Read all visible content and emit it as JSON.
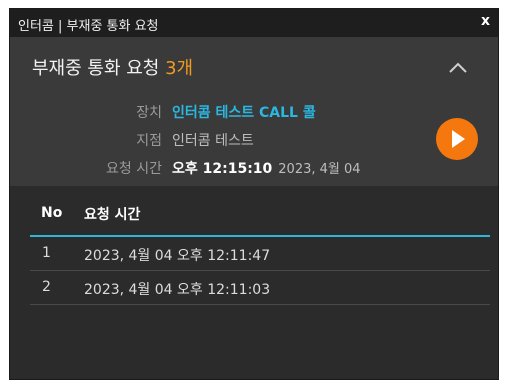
{
  "window": {
    "title": "인터콤 | 부재중 통화 요청",
    "close": "x"
  },
  "header": {
    "heading_prefix": "부재중 통화 요청 ",
    "count": "3개",
    "device_label": "장치",
    "device_value": "인터콤 테스트 CALL 콜",
    "branch_label": "지점",
    "branch_value": "인터콤 테스트",
    "request_label": "요청 시간",
    "request_time": "오후 12:15:10",
    "request_date": "2023, 4월 04"
  },
  "table": {
    "columns": [
      "No",
      "요청 시간"
    ],
    "rows": [
      {
        "no": "1",
        "time": "2023, 4월 04 오후 12:11:47"
      },
      {
        "no": "2",
        "time": "2023, 4월 04 오후 12:11:03"
      }
    ]
  },
  "colors": {
    "accent_orange": "#f39a1f",
    "play_button": "#f5780f",
    "device_blue": "#2ab7e0",
    "divider_blue": "#2fb7d8"
  },
  "icons": {
    "collapse": "chevron-up-icon",
    "play": "play-icon",
    "close": "close-icon"
  }
}
